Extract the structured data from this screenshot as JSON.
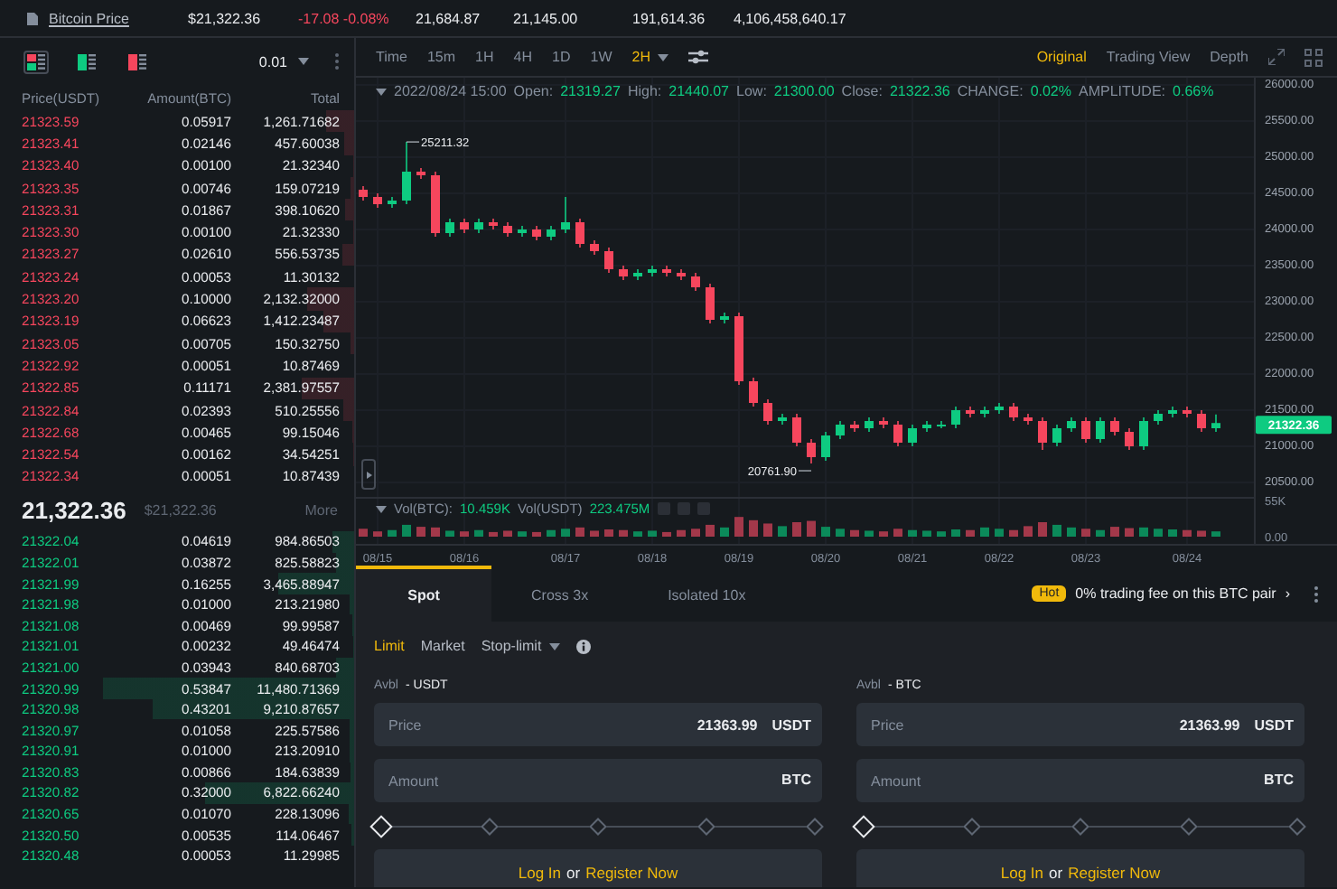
{
  "top_bar": {
    "link": "Bitcoin Price",
    "stats": [
      {
        "text": "$21,322.36",
        "kind": "plain"
      },
      {
        "text": "-17.08 -0.08%",
        "kind": "down"
      },
      {
        "text": "21,684.87",
        "kind": "plain"
      },
      {
        "text": "21,145.00",
        "kind": "plain"
      },
      {
        "text": "191,614.36",
        "kind": "plain"
      },
      {
        "text": "4,106,458,640.17",
        "kind": "plain"
      }
    ]
  },
  "order_book": {
    "views": [
      {
        "kind": "both",
        "selected": true
      },
      {
        "kind": "bids",
        "selected": false
      },
      {
        "kind": "asks",
        "selected": false
      }
    ],
    "tick_size": "0.01",
    "columns": [
      "Price(USDT)",
      "Amount(BTC)",
      "Total"
    ],
    "asks": [
      {
        "price": "21323.59",
        "amount": "0.05917",
        "total": "1,261.71682"
      },
      {
        "price": "21323.41",
        "amount": "0.02146",
        "total": "457.60038"
      },
      {
        "price": "21323.40",
        "amount": "0.00100",
        "total": "21.32340"
      },
      {
        "price": "21323.35",
        "amount": "0.00746",
        "total": "159.07219"
      },
      {
        "price": "21323.31",
        "amount": "0.01867",
        "total": "398.10620"
      },
      {
        "price": "21323.30",
        "amount": "0.00100",
        "total": "21.32330"
      },
      {
        "price": "21323.27",
        "amount": "0.02610",
        "total": "556.53735"
      },
      {
        "price": "21323.24",
        "amount": "0.00053",
        "total": "11.30132"
      },
      {
        "price": "21323.20",
        "amount": "0.10000",
        "total": "2,132.32000"
      },
      {
        "price": "21323.19",
        "amount": "0.06623",
        "total": "1,412.23487"
      },
      {
        "price": "21323.05",
        "amount": "0.00705",
        "total": "150.32750"
      },
      {
        "price": "21322.92",
        "amount": "0.00051",
        "total": "10.87469"
      },
      {
        "price": "21322.85",
        "amount": "0.11171",
        "total": "2,381.97557"
      },
      {
        "price": "21322.84",
        "amount": "0.02393",
        "total": "510.25556"
      },
      {
        "price": "21322.68",
        "amount": "0.00465",
        "total": "99.15046"
      },
      {
        "price": "21322.54",
        "amount": "0.00162",
        "total": "34.54251"
      },
      {
        "price": "21322.34",
        "amount": "0.00051",
        "total": "10.87439"
      }
    ],
    "last_price": "21,322.36",
    "last_price_usd": "$21,322.36",
    "more": "More",
    "bids": [
      {
        "price": "21322.04",
        "amount": "0.04619",
        "total": "984.86503"
      },
      {
        "price": "21322.01",
        "amount": "0.03872",
        "total": "825.58823"
      },
      {
        "price": "21321.99",
        "amount": "0.16255",
        "total": "3,465.88947"
      },
      {
        "price": "21321.98",
        "amount": "0.01000",
        "total": "213.21980"
      },
      {
        "price": "21321.08",
        "amount": "0.00469",
        "total": "99.99587"
      },
      {
        "price": "21321.01",
        "amount": "0.00232",
        "total": "49.46474"
      },
      {
        "price": "21321.00",
        "amount": "0.03943",
        "total": "840.68703"
      },
      {
        "price": "21320.99",
        "amount": "0.53847",
        "total": "11,480.71369"
      },
      {
        "price": "21320.98",
        "amount": "0.43201",
        "total": "9,210.87657"
      },
      {
        "price": "21320.97",
        "amount": "0.01058",
        "total": "225.57586"
      },
      {
        "price": "21320.91",
        "amount": "0.01000",
        "total": "213.20910"
      },
      {
        "price": "21320.83",
        "amount": "0.00866",
        "total": "184.63839"
      },
      {
        "price": "21320.82",
        "amount": "0.32000",
        "total": "6,822.66240"
      },
      {
        "price": "21320.65",
        "amount": "0.01070",
        "total": "228.13096"
      },
      {
        "price": "21320.50",
        "amount": "0.00535",
        "total": "114.06467"
      },
      {
        "price": "21320.48",
        "amount": "0.00053",
        "total": "11.29985"
      }
    ]
  },
  "chart": {
    "intervals": [
      {
        "label": "Time",
        "selected": false
      },
      {
        "label": "15m",
        "selected": false
      },
      {
        "label": "1H",
        "selected": false
      },
      {
        "label": "4H",
        "selected": false
      },
      {
        "label": "1D",
        "selected": false
      },
      {
        "label": "1W",
        "selected": false
      },
      {
        "label": "2H",
        "selected": true
      }
    ],
    "views": [
      {
        "label": "Original",
        "selected": true
      },
      {
        "label": "Trading View",
        "selected": false
      },
      {
        "label": "Depth",
        "selected": false
      }
    ],
    "ohlc": {
      "date": "2022/08/24 15:00",
      "fields": [
        {
          "label": "Open:",
          "value": "21319.27"
        },
        {
          "label": "High:",
          "value": "21440.07"
        },
        {
          "label": "Low:",
          "value": "21300.00"
        },
        {
          "label": "Close:",
          "value": "21322.36"
        },
        {
          "label": "CHANGE:",
          "value": "0.02%"
        },
        {
          "label": "AMPLITUDE:",
          "value": "0.66%"
        }
      ]
    },
    "last_price_tag": "21322.36",
    "chart_data": {
      "type": "candlestick",
      "ylim": [
        20500,
        26100
      ],
      "yticks": [
        {
          "value": 26000,
          "label": "26000.00"
        },
        {
          "value": 25500,
          "label": "25500.00"
        },
        {
          "value": 25000,
          "label": "25000.00"
        },
        {
          "value": 24500,
          "label": "24500.00"
        },
        {
          "value": 24000,
          "label": "24000.00"
        },
        {
          "value": 23500,
          "label": "23500.00"
        },
        {
          "value": 23000,
          "label": "23000.00"
        },
        {
          "value": 22500,
          "label": "22500.00"
        },
        {
          "value": 22000,
          "label": "22000.00"
        },
        {
          "value": 21500,
          "label": "21500.00"
        },
        {
          "value": 21000,
          "label": "21000.00"
        },
        {
          "value": 20500,
          "label": "20500.00"
        }
      ],
      "categories": [
        null,
        "08/15",
        null,
        null,
        null,
        null,
        null,
        "08/16",
        null,
        null,
        null,
        null,
        null,
        null,
        "08/17",
        null,
        null,
        null,
        null,
        null,
        "08/18",
        null,
        null,
        null,
        null,
        null,
        "08/19",
        null,
        null,
        null,
        null,
        null,
        "08/20",
        null,
        null,
        null,
        null,
        null,
        "08/21",
        null,
        null,
        null,
        null,
        null,
        "08/22",
        null,
        null,
        null,
        null,
        null,
        "08/23",
        null,
        null,
        null,
        null,
        null,
        null,
        "08/24",
        null,
        null
      ],
      "ohlc": [
        [
          24550,
          24600,
          24400,
          24450
        ],
        [
          24450,
          24500,
          24300,
          24350
        ],
        [
          24350,
          24450,
          24300,
          24400
        ],
        [
          24400,
          25211.32,
          24350,
          24800
        ],
        [
          24800,
          24850,
          24700,
          24750
        ],
        [
          24750,
          24800,
          23900,
          23950
        ],
        [
          23950,
          24150,
          23900,
          24100
        ],
        [
          24100,
          24150,
          23950,
          24000
        ],
        [
          24000,
          24150,
          23950,
          24100
        ],
        [
          24100,
          24150,
          24000,
          24050
        ],
        [
          24050,
          24100,
          23900,
          23950
        ],
        [
          23950,
          24050,
          23900,
          24000
        ],
        [
          24000,
          24050,
          23850,
          23900
        ],
        [
          23900,
          24050,
          23850,
          24000
        ],
        [
          24000,
          24450,
          23950,
          24100
        ],
        [
          24100,
          24150,
          23750,
          23800
        ],
        [
          23800,
          23850,
          23650,
          23700
        ],
        [
          23700,
          23750,
          23400,
          23450
        ],
        [
          23450,
          23500,
          23300,
          23350
        ],
        [
          23350,
          23450,
          23300,
          23400
        ],
        [
          23400,
          23500,
          23350,
          23450
        ],
        [
          23450,
          23500,
          23350,
          23400
        ],
        [
          23400,
          23450,
          23300,
          23350
        ],
        [
          23350,
          23400,
          23150,
          23200
        ],
        [
          23200,
          23250,
          22700,
          22750
        ],
        [
          22750,
          22850,
          22700,
          22800
        ],
        [
          22800,
          22850,
          21850,
          21900
        ],
        [
          21900,
          21950,
          21550,
          21600
        ],
        [
          21600,
          21650,
          21300,
          21350
        ],
        [
          21350,
          21450,
          21300,
          21400
        ],
        [
          21400,
          21450,
          21000,
          21050
        ],
        [
          21050,
          21100,
          20761.9,
          20850
        ],
        [
          20850,
          21200,
          20800,
          21150
        ],
        [
          21150,
          21350,
          21100,
          21300
        ],
        [
          21300,
          21350,
          21200,
          21250
        ],
        [
          21250,
          21400,
          21200,
          21350
        ],
        [
          21350,
          21400,
          21250,
          21300
        ],
        [
          21300,
          21350,
          21000,
          21050
        ],
        [
          21050,
          21300,
          21000,
          21250
        ],
        [
          21250,
          21350,
          21200,
          21300
        ],
        [
          21300,
          21350,
          21250,
          21300
        ],
        [
          21300,
          21550,
          21250,
          21500
        ],
        [
          21500,
          21550,
          21400,
          21450
        ],
        [
          21450,
          21550,
          21400,
          21500
        ],
        [
          21500,
          21600,
          21450,
          21550
        ],
        [
          21550,
          21600,
          21350,
          21400
        ],
        [
          21400,
          21450,
          21300,
          21350
        ],
        [
          21350,
          21400,
          20950,
          21050
        ],
        [
          21050,
          21300,
          21000,
          21250
        ],
        [
          21250,
          21400,
          21200,
          21350
        ],
        [
          21350,
          21400,
          21050,
          21100
        ],
        [
          21100,
          21400,
          21050,
          21350
        ],
        [
          21350,
          21400,
          21150,
          21200
        ],
        [
          21200,
          21250,
          20950,
          21000
        ],
        [
          21000,
          21400,
          20950,
          21350
        ],
        [
          21350,
          21500,
          21300,
          21450
        ],
        [
          21450,
          21550,
          21400,
          21500
        ],
        [
          21500,
          21550,
          21400,
          21450
        ],
        [
          21450,
          21500,
          21200,
          21250
        ],
        [
          21250,
          21440.07,
          21200,
          21322.36
        ]
      ],
      "annotations": [
        "25211.32",
        "20761.90"
      ]
    },
    "volume": {
      "legend": [
        {
          "label": "Vol(BTC):",
          "value": "10.459K"
        },
        {
          "label": "Vol(USDT)",
          "value": "223.475M"
        }
      ],
      "chart_data": {
        "type": "bar",
        "ylim": [
          0,
          55
        ],
        "yticks": [
          {
            "value": 55,
            "label": "55K"
          },
          {
            "value": 0,
            "label": "0.00"
          }
        ],
        "categories": [
          null,
          null,
          null,
          null,
          null,
          null,
          null,
          null,
          null,
          null,
          null,
          null,
          null,
          null,
          null,
          null,
          null,
          null,
          null,
          null,
          null,
          null,
          null,
          null,
          null,
          null,
          null,
          null,
          null,
          null,
          null,
          null,
          null,
          null,
          null,
          null,
          null,
          null,
          null,
          null,
          null,
          null,
          null,
          null,
          null,
          null,
          null,
          null,
          null,
          null,
          null,
          null,
          null,
          null,
          null,
          null,
          null,
          null,
          null,
          null
        ],
        "series": [
          {
            "values": [
              12,
              8,
              10,
              18,
              15,
              14,
              9,
              8,
              10,
              7,
              9,
              8,
              7,
              10,
              12,
              14,
              9,
              11,
              10,
              8,
              9,
              7,
              10,
              12,
              18,
              14,
              30,
              25,
              20,
              16,
              22,
              24,
              15,
              12,
              10,
              9,
              8,
              12,
              10,
              9,
              8,
              11,
              10,
              14,
              12,
              10,
              16,
              22,
              18,
              14,
              12,
              10,
              15,
              13,
              14,
              12,
              11,
              10,
              9,
              8
            ]
          }
        ]
      }
    }
  },
  "trade": {
    "tabs": [
      {
        "label": "Spot",
        "selected": true
      },
      {
        "label": "Cross 3x",
        "selected": false
      },
      {
        "label": "Isolated 10x",
        "selected": false
      }
    ],
    "promo": {
      "badge": "Hot",
      "text": "0% trading fee on this BTC pair",
      "arrow": "›"
    },
    "order_types": [
      {
        "label": "Limit",
        "selected": true,
        "dropdown": false
      },
      {
        "label": "Market",
        "selected": false,
        "dropdown": false
      },
      {
        "label": "Stop-limit",
        "selected": false,
        "dropdown": true
      }
    ],
    "sides": [
      {
        "avbl_label": "Avbl",
        "avbl_value": "- USDT",
        "price": {
          "label": "Price",
          "value": "21363.99",
          "unit": "USDT"
        },
        "amount": {
          "placeholder": "Amount",
          "unit": "BTC"
        },
        "slider": {
          "level": 0
        },
        "login": {
          "login": "Log In",
          "or": "or",
          "register": "Register Now"
        }
      },
      {
        "avbl_label": "Avbl",
        "avbl_value": "- BTC",
        "price": {
          "label": "Price",
          "value": "21363.99",
          "unit": "USDT"
        },
        "amount": {
          "placeholder": "Amount",
          "unit": "BTC"
        },
        "slider": {
          "level": 0
        },
        "login": {
          "login": "Log In",
          "or": "or",
          "register": "Register Now"
        }
      }
    ]
  }
}
